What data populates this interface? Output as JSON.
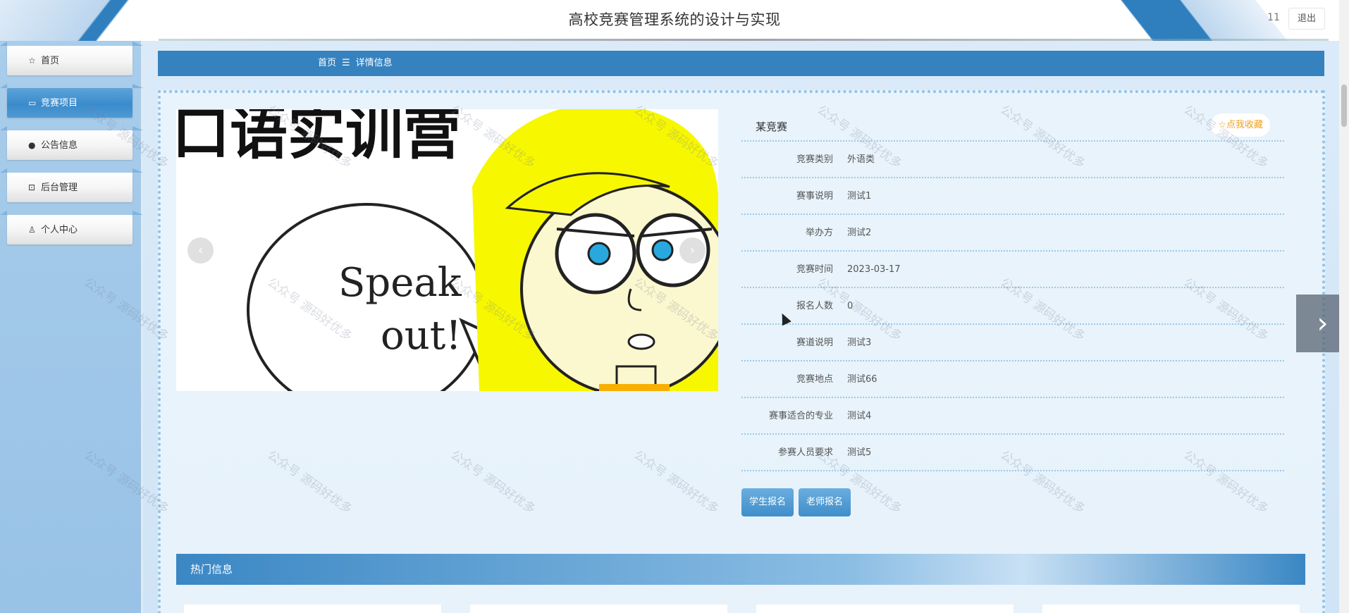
{
  "header": {
    "title": "高校竞赛管理系统的设计与实现",
    "user_id": "11",
    "logout_label": "退出"
  },
  "sidebar": {
    "items": [
      {
        "label": "首页",
        "icon": "star-outline-icon",
        "active": false
      },
      {
        "label": "竞赛项目",
        "icon": "bag-icon",
        "active": true
      },
      {
        "label": "公告信息",
        "icon": "alert-circle-icon",
        "active": false
      },
      {
        "label": "后台管理",
        "icon": "briefcase-icon",
        "active": false
      },
      {
        "label": "个人中心",
        "icon": "user-icon",
        "active": false
      }
    ]
  },
  "breadcrumb": {
    "home": "首页",
    "separator": "☰",
    "current": "详情信息"
  },
  "detail": {
    "title": "某竞赛",
    "favorite_label": "☆点我收藏",
    "rows": [
      {
        "label": "竞赛类别",
        "value": "外语类"
      },
      {
        "label": "赛事说明",
        "value": "测试1"
      },
      {
        "label": "举办方",
        "value": "测试2"
      },
      {
        "label": "竞赛时间",
        "value": "2023-03-17"
      },
      {
        "label": "报名人数",
        "value": "0"
      },
      {
        "label": "赛道说明",
        "value": "测试3"
      },
      {
        "label": "竞赛地点",
        "value": "测试66"
      },
      {
        "label": "赛事适合的专业",
        "value": "测试4"
      },
      {
        "label": "参赛人员要求",
        "value": "测试5"
      }
    ],
    "buttons": {
      "student_signup": "学生报名",
      "teacher_signup": "老师报名"
    }
  },
  "gallery": {
    "banner_text": "口语实训营",
    "bubble_text_1": "Speak",
    "bubble_text_2": "out!"
  },
  "hot": {
    "title": "热门信息"
  },
  "watermark_text": "公众号 源码好优多",
  "colors": {
    "primary": "#3582bf",
    "sidebar_bg": "#a9cdeb",
    "favorite": "#f0a020"
  }
}
